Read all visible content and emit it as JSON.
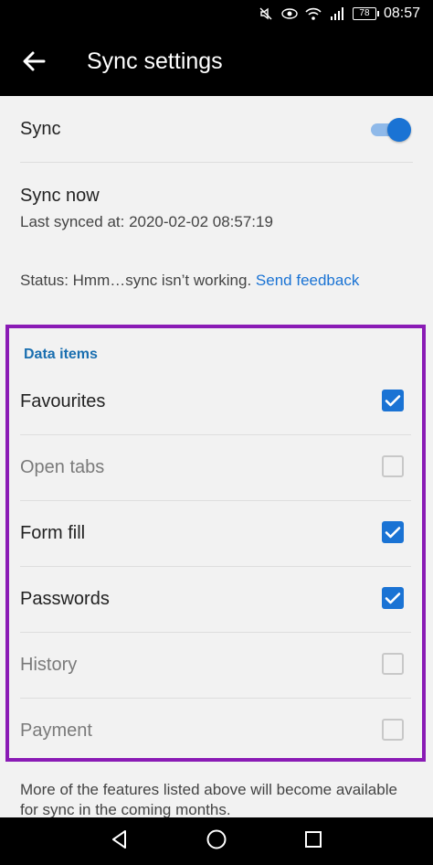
{
  "status_bar": {
    "icons": [
      "mute-icon",
      "eye-icon",
      "wifi-icon",
      "signal-icon"
    ],
    "battery": "78",
    "time": "08:57"
  },
  "app_bar": {
    "back_icon": "arrow-left-icon",
    "title": "Sync settings"
  },
  "sync": {
    "label": "Sync",
    "enabled": true
  },
  "sync_now": {
    "label": "Sync now",
    "last_synced": "Last synced at: 2020-02-02 08:57:19"
  },
  "status": {
    "text": "Status: Hmm…sync isn’t working.",
    "link": "Send feedback"
  },
  "data_items": {
    "heading": "Data items",
    "items": [
      {
        "label": "Favourites",
        "checked": true,
        "enabled": true
      },
      {
        "label": "Open tabs",
        "checked": false,
        "enabled": false
      },
      {
        "label": "Form fill",
        "checked": true,
        "enabled": true
      },
      {
        "label": "Passwords",
        "checked": true,
        "enabled": true
      },
      {
        "label": "History",
        "checked": false,
        "enabled": false
      },
      {
        "label": "Payment",
        "checked": false,
        "enabled": false
      }
    ]
  },
  "footnote": "More of the features listed above will become available for sync in the coming months.",
  "colors": {
    "accent": "#1a73d4",
    "highlight_border": "#8a1bb5",
    "section_heading": "#1a6fb0"
  },
  "nav_bar": {
    "icons": [
      "back-triangle-icon",
      "home-circle-icon",
      "recents-square-icon"
    ]
  }
}
